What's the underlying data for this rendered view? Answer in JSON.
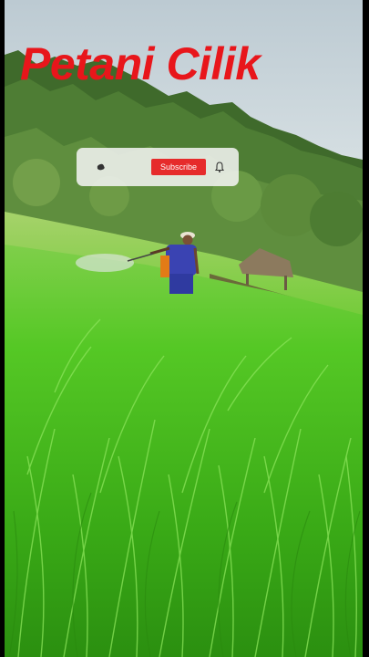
{
  "overlay": {
    "title": "Petani Cilik",
    "subscribe_label": "Subscribe"
  },
  "icons": {
    "channel": "channel-logo-icon",
    "bell": "bell-icon"
  },
  "colors": {
    "title": "#e8161b",
    "subscribe_button": "#e62b2b",
    "rice_field": "#5fd52a",
    "sky": "#c9d8df"
  },
  "scene": {
    "subject": "farmer spraying rice field"
  }
}
